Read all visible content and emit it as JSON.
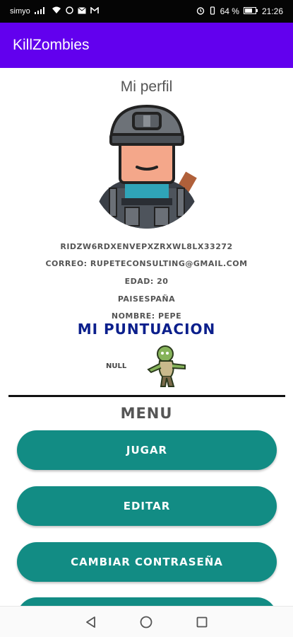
{
  "status_bar": {
    "carrier": "simyo",
    "battery": "64 %",
    "time": "21:26"
  },
  "app_bar": {
    "title": "KillZombies"
  },
  "profile": {
    "title": "Mi perfil",
    "user_id": "RIDZW6RDXENVEPXZRXWL8LX33272",
    "email": "CORREO: RUPETECONSULTING@GMAIL.COM",
    "age": "EDAD: 20",
    "country": "PAISESPAÑA",
    "name": "NOMBRE: PEPE"
  },
  "score": {
    "title": "MI PUNTUACION",
    "value": "NULL"
  },
  "menu": {
    "title": "MENU",
    "buttons": [
      "JUGAR",
      "EDITAR",
      "CAMBIAR CONTRASEÑA",
      ""
    ]
  },
  "icons": {
    "avatar": "soldier-avatar-icon",
    "zombie": "zombie-icon",
    "back": "back-triangle-icon",
    "home": "home-circle-icon",
    "recents": "recents-square-icon"
  },
  "colors": {
    "app_bar": "#6200ee",
    "status_bar": "#050505",
    "button": "#128c84",
    "score_title": "#0b1f8c",
    "text": "#555555"
  }
}
